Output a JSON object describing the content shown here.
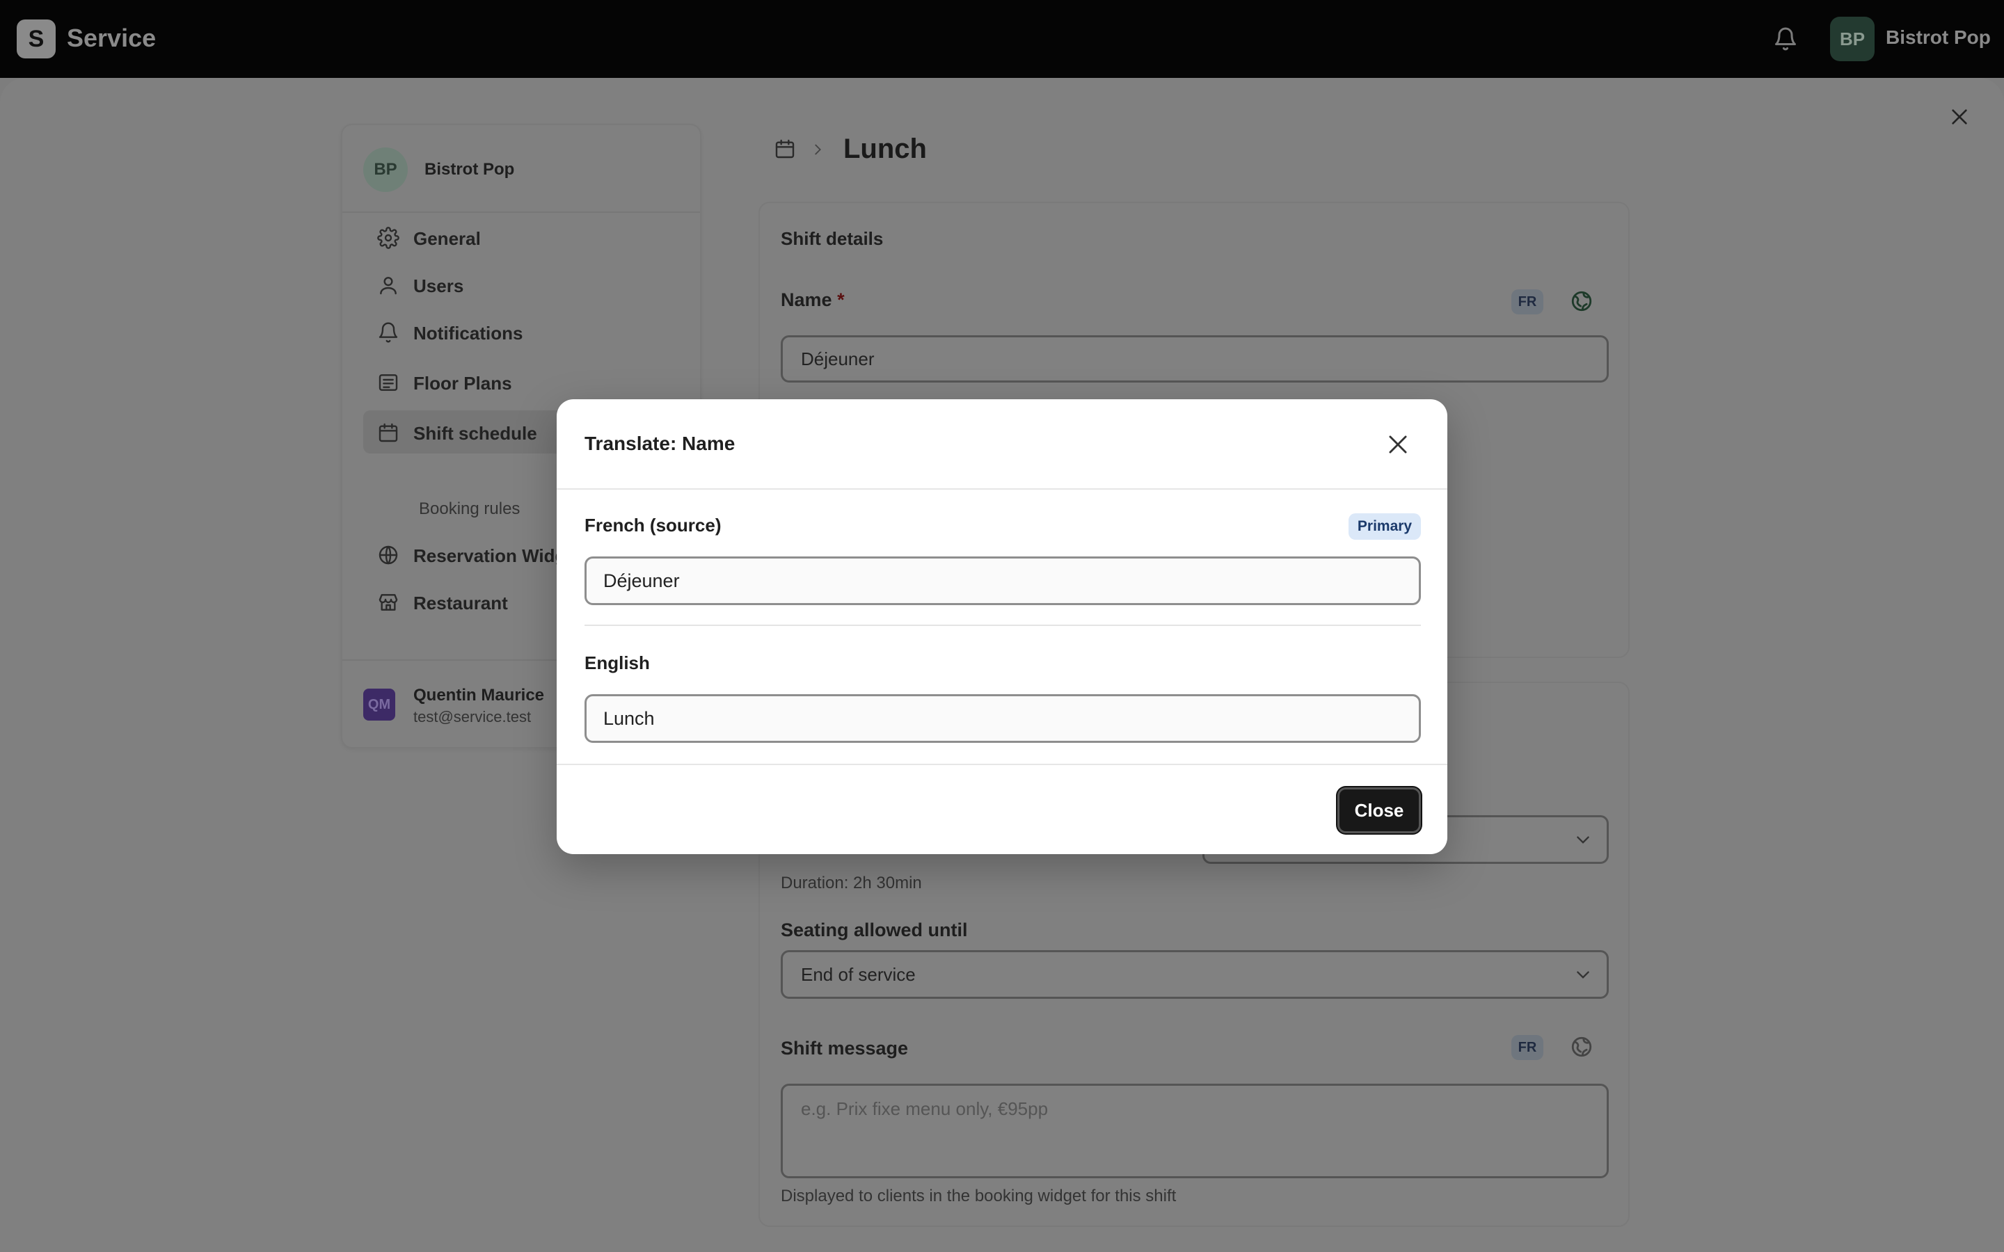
{
  "topbar": {
    "logo_letter": "S",
    "app_name": "Service",
    "user_initials": "BP",
    "user_name": "Bistrot Pop"
  },
  "sidebar": {
    "org_initials": "BP",
    "org_name": "Bistrot Pop",
    "items": [
      {
        "label": "General",
        "icon": "gear-icon"
      },
      {
        "label": "Users",
        "icon": "user-icon"
      },
      {
        "label": "Notifications",
        "icon": "bell-icon"
      },
      {
        "label": "Floor Plans",
        "icon": "floor-plan-icon"
      },
      {
        "label": "Shift schedule",
        "icon": "calendar-icon",
        "active": true
      },
      {
        "label": "Booking rules",
        "sub": true
      },
      {
        "label": "Reservation Widget",
        "icon": "globe-icon"
      },
      {
        "label": "Restaurant",
        "icon": "store-icon"
      }
    ],
    "footer": {
      "initials": "QM",
      "name": "Quentin Maurice",
      "email": "test@service.test"
    }
  },
  "breadcrumb": {
    "title": "Lunch"
  },
  "shift_details": {
    "title": "Shift details",
    "name_label": "Name",
    "required_mark": "*",
    "lang_badge": "FR",
    "name_value": "Déjeuner"
  },
  "schedule": {
    "duration_text": "Duration: 2h 30min",
    "seating_label": "Seating allowed until",
    "seating_value": "End of service",
    "message_label": "Shift message",
    "message_badge": "FR",
    "message_placeholder": "e.g. Prix fixe menu only, €95pp",
    "message_help": "Displayed to clients in the booking widget for this shift"
  },
  "modal": {
    "title": "Translate: Name",
    "source_label": "French (source)",
    "primary_badge": "Primary",
    "source_value": "Déjeuner",
    "target_label": "English",
    "target_value": "Lunch",
    "close_button": "Close"
  },
  "colors": {
    "overlay": "#7d7d7d",
    "topbar": "#050505",
    "modal_bg": "#ffffff",
    "primary_badge_bg": "#dbe8f8",
    "button_bg": "#181818"
  }
}
